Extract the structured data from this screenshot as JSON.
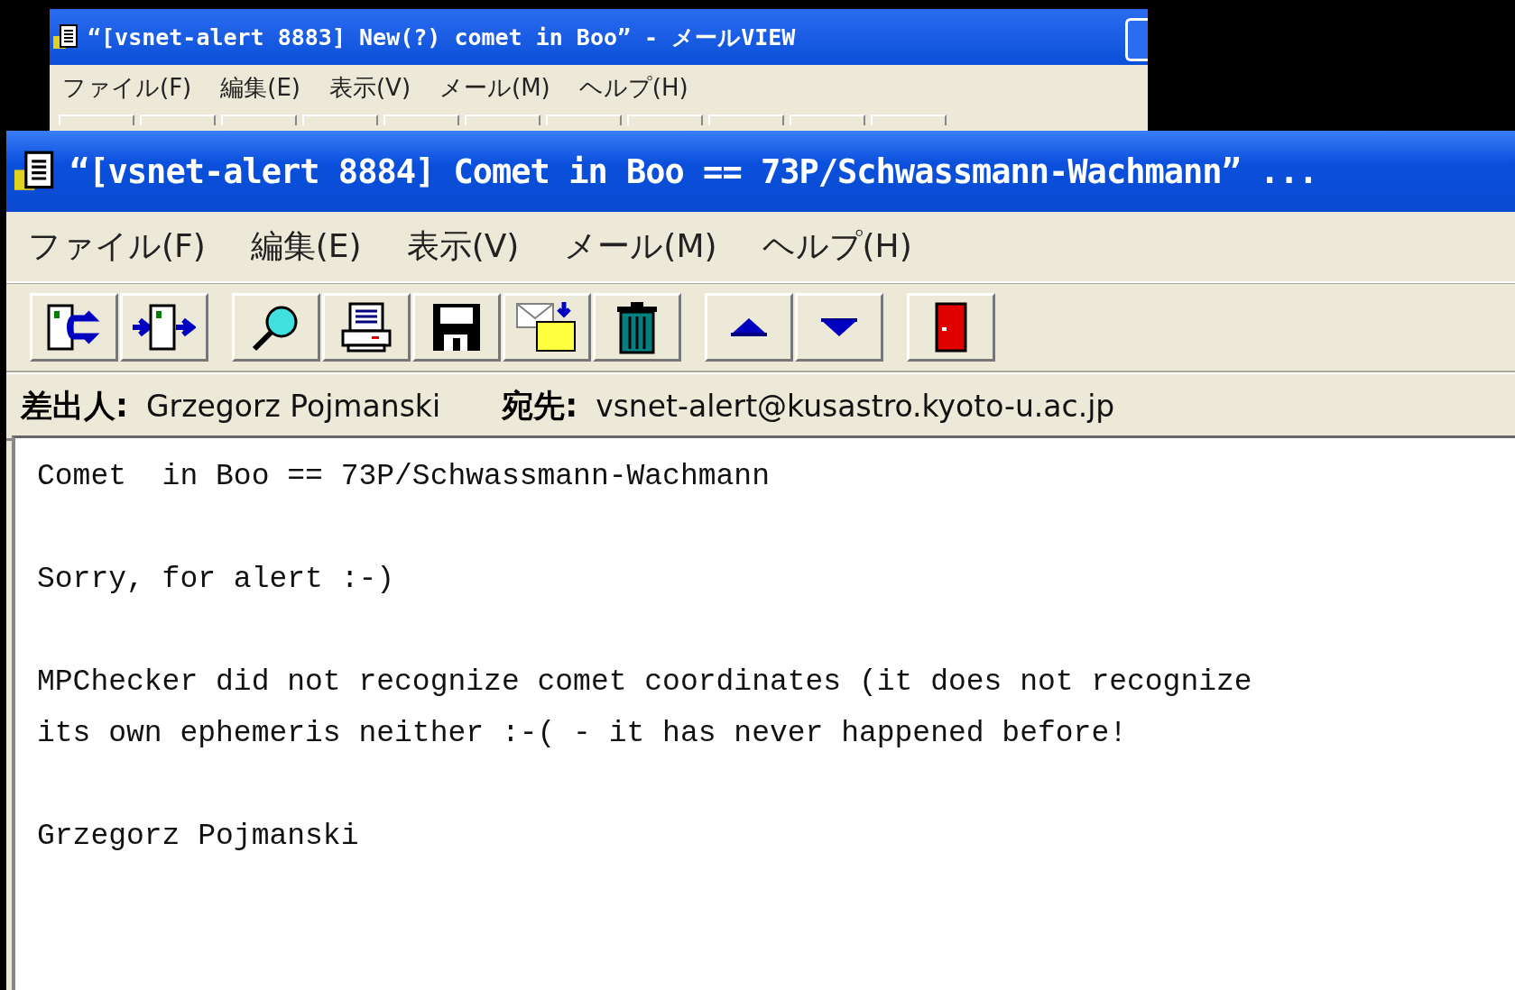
{
  "back_window": {
    "title": "“[vsnet-alert 8883] New(?) comet in Boo” - メールVIEW",
    "menu": [
      "ファイル(F)",
      "編集(E)",
      "表示(V)",
      "メール(M)",
      "ヘルプ(H)"
    ]
  },
  "window": {
    "title": "“[vsnet-alert 8884] Comet in Boo == 73P/Schwassmann-Wachmann” ...",
    "menu": [
      "ファイル(F)",
      "編集(E)",
      "表示(V)",
      "メール(M)",
      "ヘルプ(H)"
    ]
  },
  "header": [
    {
      "label": "差出人:",
      "value": "Grzegorz Pojmanski"
    },
    {
      "label": "宛先:",
      "value": "vsnet-alert@kusastro.kyoto-u.ac.jp"
    }
  ],
  "body": [
    {
      "lines": [
        "Comet  in Boo == 73P/Schwassmann-Wachmann"
      ]
    },
    {
      "lines": [
        "Sorry, for alert :-)"
      ]
    },
    {
      "lines": [
        "MPChecker did not recognize comet coordinates (it does not recognize",
        "its own ephemeris neither :-( - it has never happened before!"
      ]
    },
    {
      "lines": [
        "Grzegorz Pojmanski"
      ]
    }
  ]
}
